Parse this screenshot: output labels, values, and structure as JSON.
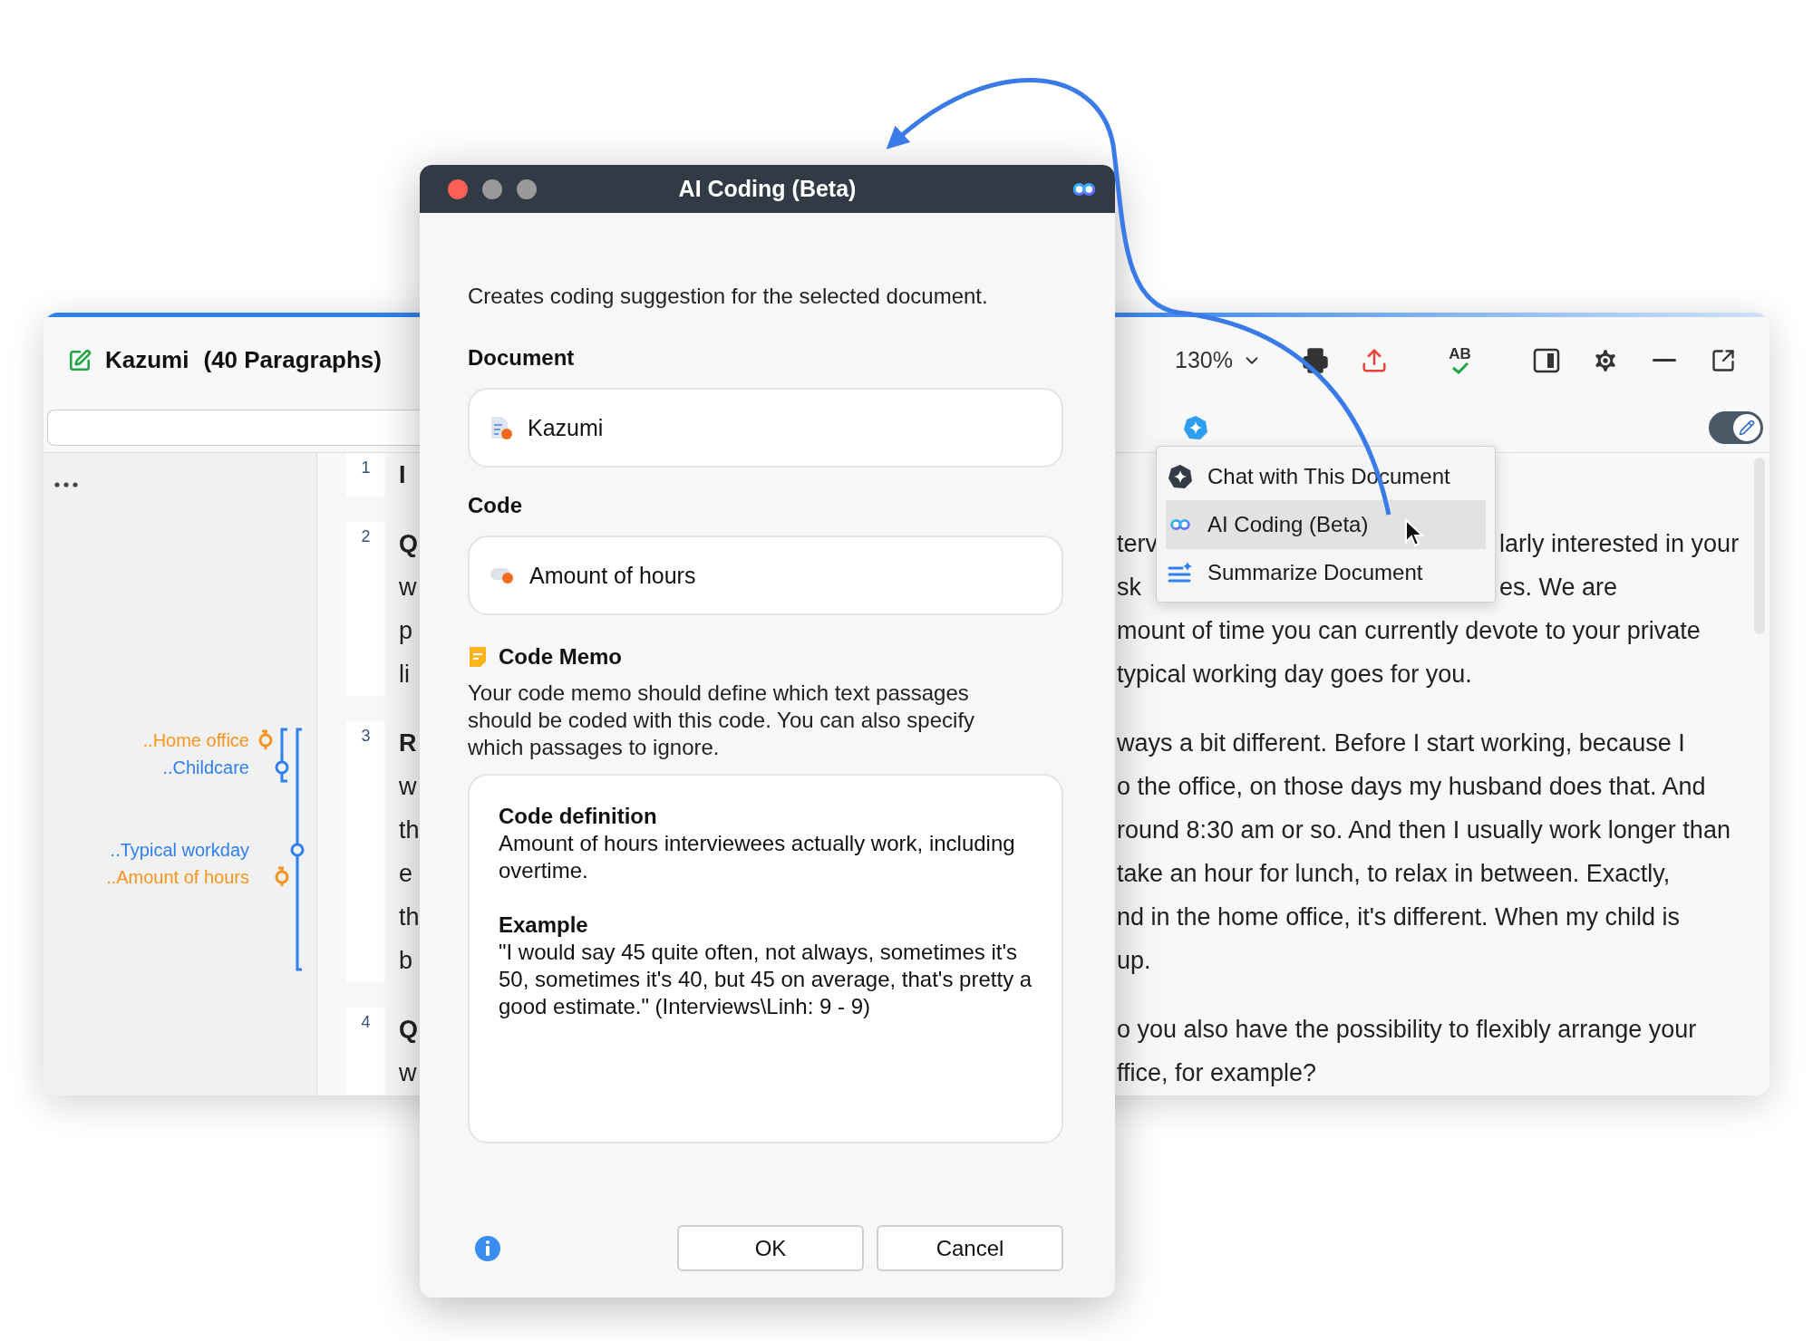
{
  "document_window": {
    "title": "Kazumi",
    "subtitle": "(40 Paragraphs)",
    "zoom": "130%",
    "spellcheck_label": "AB",
    "edit_mode": {
      "on": true
    },
    "code_groups": [
      {
        "codes": [
          {
            "label": "..Home office",
            "color": "#f7941d"
          },
          {
            "label": "..Childcare",
            "color": "#2f80ed"
          }
        ]
      },
      {
        "codes": [
          {
            "label": "..Typical workday",
            "color": "#2f80ed"
          },
          {
            "label": "..Amount of hours",
            "color": "#f7941d"
          }
        ]
      }
    ],
    "paragraphs": [
      {
        "number": "1",
        "lines": [
          {
            "start": "I",
            "speaker": true
          }
        ]
      },
      {
        "number": "2",
        "lines": [
          {
            "start": "Q",
            "speaker": true,
            "rest": [
              "terv",
              "larly interested in your"
            ]
          },
          {
            "start": "w",
            "speaker": false,
            "rest": [
              "sk",
              "es. We are"
            ]
          },
          {
            "start": "p",
            "speaker": false,
            "rest": [
              "mount of time you can currently devote to your private"
            ]
          },
          {
            "start": "li",
            "speaker": false,
            "rest": [
              "typical working day goes for you."
            ]
          }
        ]
      },
      {
        "number": "3",
        "lines": [
          {
            "start": "R",
            "speaker": true,
            "rest": [
              "ways a bit different. Before I start working, because I"
            ]
          },
          {
            "start": "w",
            "speaker": false,
            "rest": [
              "o the office, on those days my husband does that. And"
            ]
          },
          {
            "start": "th",
            "speaker": false,
            "rest": [
              "round 8:30 am or so. And then I usually work longer than"
            ]
          },
          {
            "start": "e",
            "speaker": false,
            "rest": [
              "take an hour for lunch, to relax in between. Exactly,"
            ]
          },
          {
            "start": "th",
            "speaker": false,
            "rest": [
              "nd in the home office, it's different. When my child is"
            ]
          },
          {
            "start": "b",
            "speaker": false,
            "rest": [
              "up."
            ]
          }
        ]
      },
      {
        "number": "4",
        "lines": [
          {
            "start": "Q",
            "speaker": true,
            "rest": [
              "o you also have the possibility to flexibly arrange your"
            ]
          },
          {
            "start": "w",
            "speaker": false,
            "rest": [
              "ffice, for example?"
            ]
          }
        ]
      }
    ]
  },
  "context_menu": {
    "items": [
      {
        "kind": "chat",
        "label": "Chat with This Document",
        "selected": false
      },
      {
        "kind": "coding",
        "label": "AI Coding (Beta)",
        "selected": true
      },
      {
        "kind": "summarize",
        "label": "Summarize Document",
        "selected": false
      }
    ]
  },
  "dialog": {
    "title": "AI Coding (Beta)",
    "description": "Creates coding suggestion for the selected document.",
    "document_label": "Document",
    "document_value": "Kazumi",
    "code_label": "Code",
    "code_value": "Amount of hours",
    "memo_label": "Code Memo",
    "memo_hint": "Your code memo should define which text passages should be coded with this code. You can also specify which passages to ignore.",
    "memo": {
      "definition_heading": "Code definition",
      "definition": "Amount of hours interviewees actually work, including overtime.",
      "example_heading": "Example",
      "example": "\"I would say 45 quite often, not always, sometimes it's 50, sometimes it's 40, but 45 on average, that's pretty a good estimate.\" (Interviews\\Linh: 9 - 9)"
    },
    "buttons": [
      "OK",
      "Cancel"
    ]
  }
}
